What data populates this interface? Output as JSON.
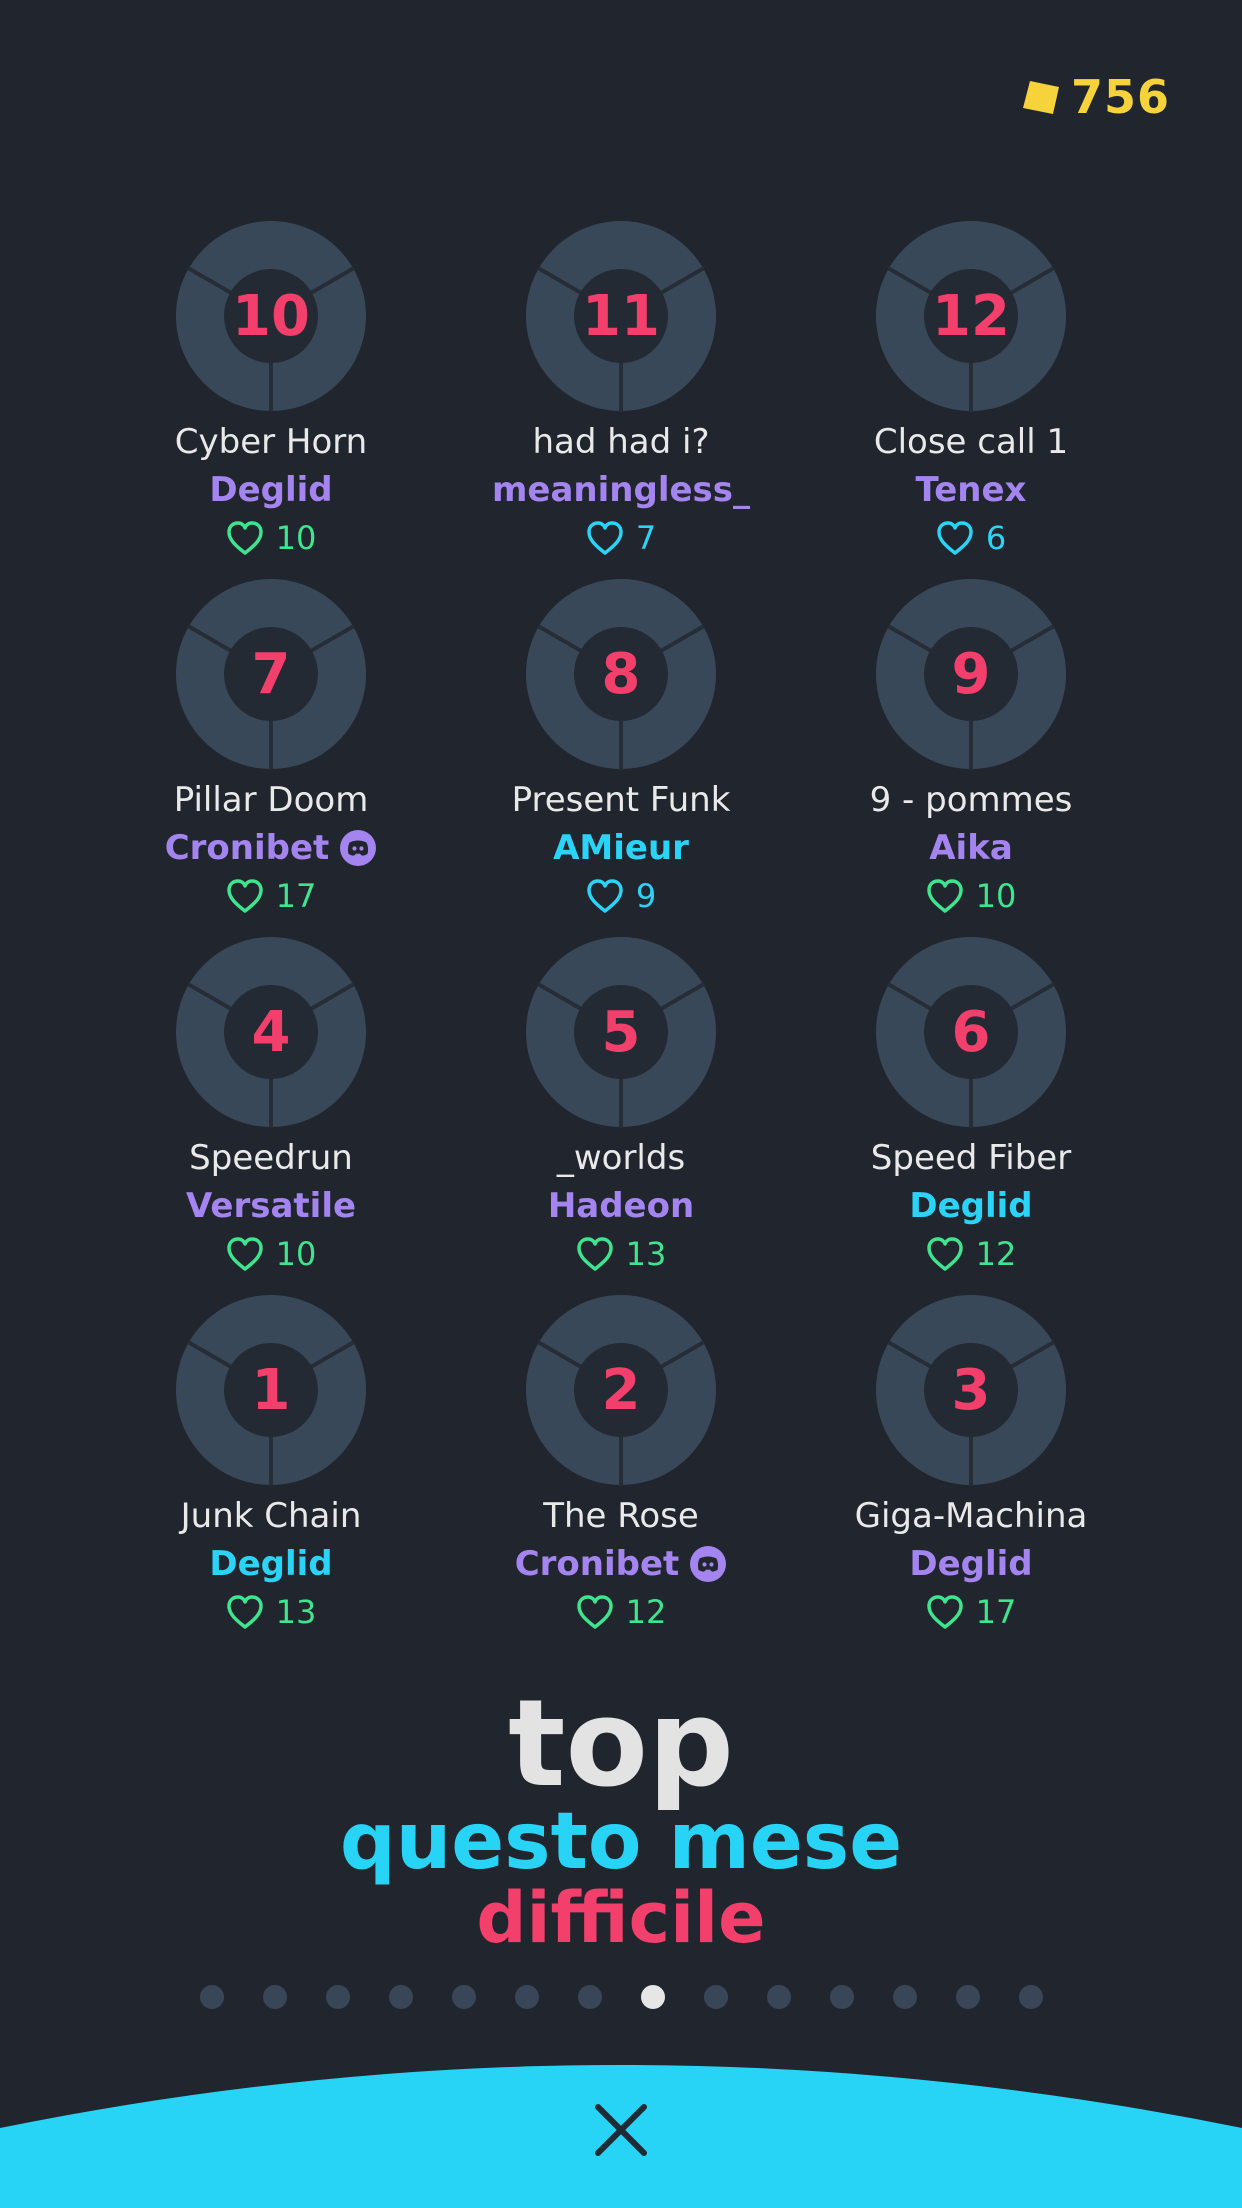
{
  "currency": {
    "value": "756",
    "icon": "cube-gem-icon",
    "color": "#f6d33b"
  },
  "levels": [
    {
      "number": "10",
      "title": "Cyber Horn",
      "author": "Deglid",
      "author_color": "purple",
      "likes": "10",
      "like_color": "green",
      "discord": false
    },
    {
      "number": "11",
      "title": "had had i?",
      "author": "meaningless_",
      "author_color": "purple",
      "likes": "7",
      "like_color": "cyan",
      "discord": false
    },
    {
      "number": "12",
      "title": "Close call 1",
      "author": "Tenex",
      "author_color": "purple",
      "likes": "6",
      "like_color": "cyan",
      "discord": false
    },
    {
      "number": "7",
      "title": "Pillar Doom",
      "author": "Cronibet",
      "author_color": "purple",
      "likes": "17",
      "like_color": "green",
      "discord": true
    },
    {
      "number": "8",
      "title": "Present Funk",
      "author": "AMieur",
      "author_color": "cyan",
      "likes": "9",
      "like_color": "cyan",
      "discord": false
    },
    {
      "number": "9",
      "title": "9 - pommes",
      "author": "Aika",
      "author_color": "purple",
      "likes": "10",
      "like_color": "green",
      "discord": false
    },
    {
      "number": "4",
      "title": "Speedrun",
      "author": "Versatile",
      "author_color": "purple",
      "likes": "10",
      "like_color": "green",
      "discord": false
    },
    {
      "number": "5",
      "title": "_worlds",
      "author": "Hadeon",
      "author_color": "purple",
      "likes": "13",
      "like_color": "green",
      "discord": false
    },
    {
      "number": "6",
      "title": "Speed Fiber",
      "author": "Deglid",
      "author_color": "cyan",
      "likes": "12",
      "like_color": "green",
      "discord": false
    },
    {
      "number": "1",
      "title": "Junk Chain",
      "author": "Deglid",
      "author_color": "cyan",
      "likes": "13",
      "like_color": "green",
      "discord": false
    },
    {
      "number": "2",
      "title": "The Rose",
      "author": "Cronibet",
      "author_color": "purple",
      "likes": "12",
      "like_color": "green",
      "discord": true
    },
    {
      "number": "3",
      "title": "Giga-Machina",
      "author": "Deglid",
      "author_color": "purple",
      "likes": "17",
      "like_color": "green",
      "discord": false
    }
  ],
  "heading": {
    "top": "top",
    "period": "questo mese",
    "difficulty": "difficile"
  },
  "pagination": {
    "total": 14,
    "active_index": 7
  },
  "close": {
    "icon": "close-icon"
  },
  "colors": {
    "background": "#21262e",
    "accent_cyan": "#28d4f6",
    "accent_pink": "#f23f6c",
    "author_purple": "#a485f0",
    "like_green": "#3ee58e"
  }
}
